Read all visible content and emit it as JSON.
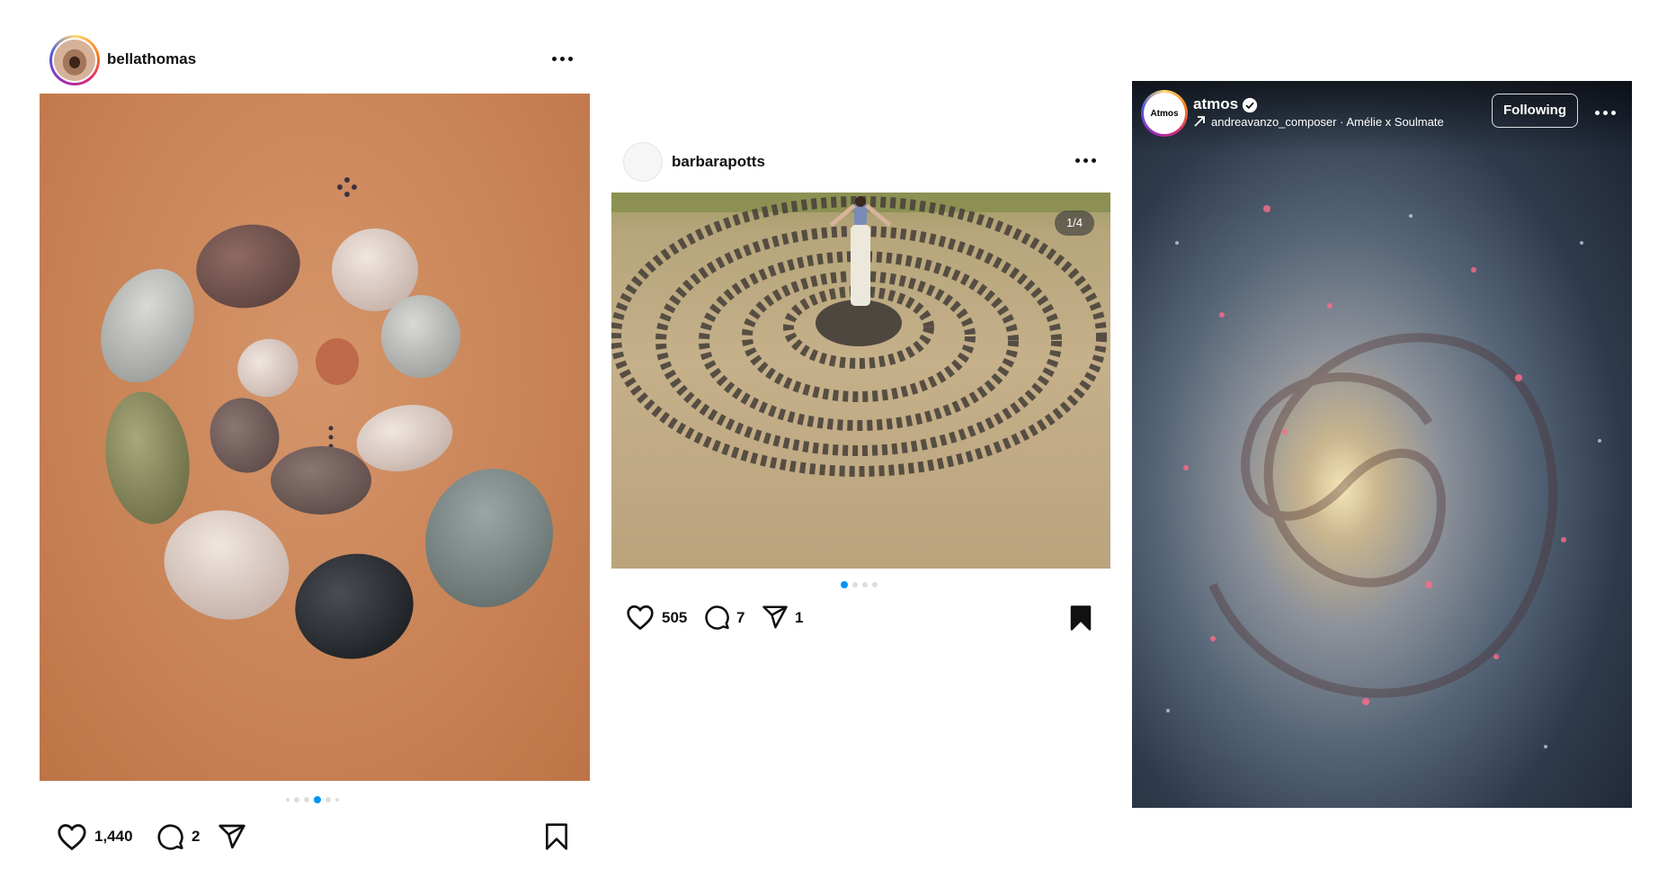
{
  "posts": [
    {
      "username": "bellathomas",
      "likes": "1,440",
      "comments": "2",
      "carousel": {
        "count": 6,
        "active_index": 3
      }
    },
    {
      "username": "barbarapotts",
      "badge": "1/4",
      "likes": "505",
      "comments": "7",
      "shares": "1",
      "carousel": {
        "count": 4,
        "active_index": 0
      }
    },
    {
      "username": "atmos",
      "avatar_text": "Atmos",
      "audio": "andreavanzo_composer · Amélie x Soulmate",
      "follow_label": "Following"
    }
  ],
  "colors": {
    "accent": "#0095f6",
    "text": "#111111"
  },
  "icons": [
    "more-icon",
    "heart-icon",
    "comment-icon",
    "share-icon",
    "bookmark-icon",
    "verified-icon",
    "arrow-icon"
  ]
}
